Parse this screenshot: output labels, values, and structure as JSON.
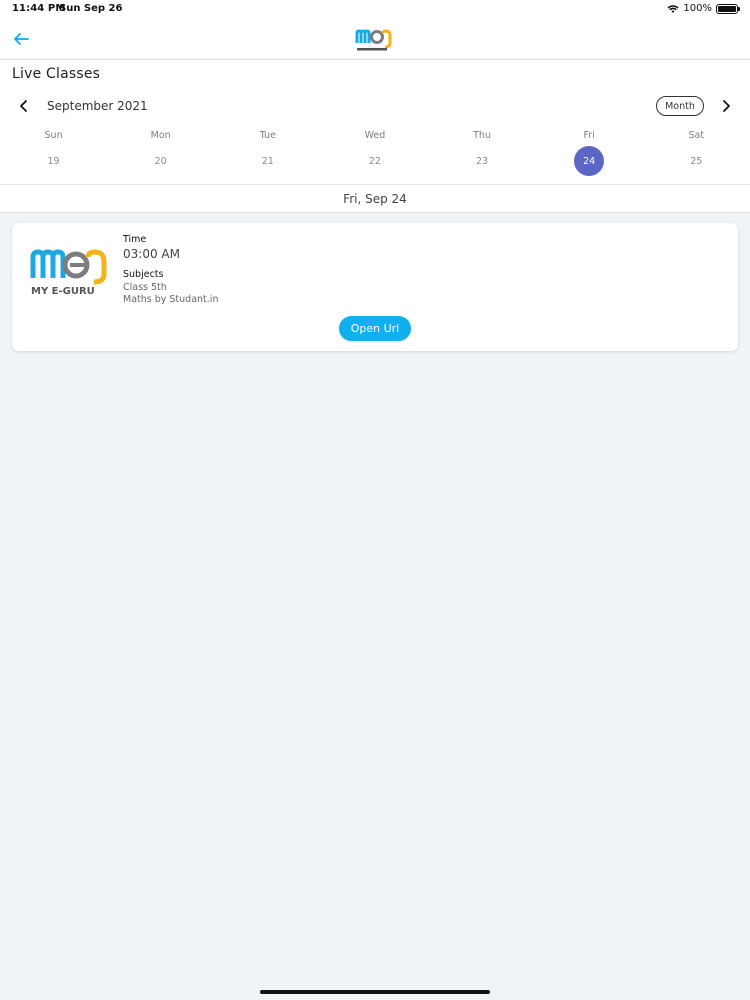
{
  "status_bar": {
    "time": "11:44 PM",
    "date": "Sun Sep 26",
    "battery": "100%"
  },
  "header": {
    "logo_icon": "meg-logo-icon",
    "back_icon": "back-arrow-icon"
  },
  "page": {
    "title": "Live Classes"
  },
  "calendar": {
    "month_label": "September 2021",
    "view_toggle": "Month",
    "prev_icon": "chevron-left-icon",
    "next_icon": "chevron-right-icon",
    "days": [
      {
        "name": "Sun",
        "num": "19"
      },
      {
        "name": "Mon",
        "num": "20"
      },
      {
        "name": "Tue",
        "num": "21"
      },
      {
        "name": "Wed",
        "num": "22"
      },
      {
        "name": "Thu",
        "num": "23"
      },
      {
        "name": "Fri",
        "num": "24"
      },
      {
        "name": "Sat",
        "num": "25"
      }
    ],
    "selected_day_index": 5,
    "selected_label": "Fri, Sep 24"
  },
  "class_card": {
    "logo_text": "MY E-GURU",
    "time_label": "Time",
    "time_value": "03:00 AM",
    "subjects_label": "Subjects",
    "class_value": "Class 5th",
    "subject_value": "Maths by Studant.in",
    "button_label": "Open Url"
  },
  "colors": {
    "accent_blue": "#10b0ef",
    "selected_day": "#5c67c4",
    "logo_blue": "#1aa9e1",
    "logo_gray": "#7b7d80",
    "logo_yellow": "#f6b21b",
    "page_bg": "#f1f4f7"
  }
}
